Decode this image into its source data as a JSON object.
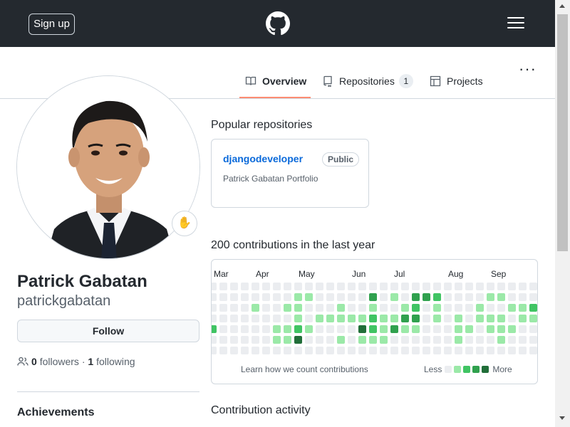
{
  "header": {
    "signup_label": "Sign up",
    "logo_icon": "github-icon",
    "menu_icon": "hamburger-menu-icon"
  },
  "tabs": [
    {
      "label": "Overview",
      "icon": "book-icon",
      "selected": true
    },
    {
      "label": "Repositories",
      "icon": "repo-icon",
      "count": "1"
    },
    {
      "label": "Projects",
      "icon": "table-icon"
    }
  ],
  "more_menu": "···",
  "profile": {
    "name": "Patrick Gabatan",
    "login": "patrickgabatan",
    "follow_label": "Follow",
    "followers_count": "0",
    "followers_label": "followers",
    "separator": "·",
    "following_count": "1",
    "following_label": "following",
    "status_emoji": "✋",
    "achievements_heading": "Achievements"
  },
  "popular": {
    "heading": "Popular repositories",
    "repos": [
      {
        "name": "djangodeveloper",
        "visibility": "Public",
        "description": "Patrick Gabatan Portfolio"
      }
    ]
  },
  "contributions": {
    "heading": "200 contributions in the last year",
    "months": [
      "Mar",
      "Apr",
      "May",
      "Jun",
      "Jul",
      "Aug",
      "Sep"
    ],
    "learn_link": "Learn how we count contributions",
    "legend_less": "Less",
    "legend_more": "More",
    "colors": [
      "#ebedf0",
      "#9be9a8",
      "#40c463",
      "#30a14e",
      "#216e39"
    ],
    "weeks": [
      [
        0,
        0,
        0,
        0,
        2,
        0,
        0
      ],
      [
        0,
        0,
        0,
        0,
        0,
        0,
        0
      ],
      [
        0,
        0,
        0,
        0,
        0,
        0,
        0
      ],
      [
        0,
        0,
        0,
        0,
        0,
        0,
        0
      ],
      [
        0,
        0,
        1,
        0,
        0,
        0,
        0
      ],
      [
        0,
        0,
        0,
        0,
        0,
        0,
        0
      ],
      [
        0,
        0,
        0,
        0,
        1,
        1,
        0
      ],
      [
        0,
        0,
        1,
        0,
        1,
        1,
        0
      ],
      [
        0,
        1,
        1,
        1,
        2,
        4,
        0
      ],
      [
        0,
        1,
        0,
        0,
        1,
        0,
        0
      ],
      [
        0,
        0,
        0,
        1,
        0,
        0,
        0
      ],
      [
        0,
        0,
        0,
        1,
        0,
        0,
        0
      ],
      [
        0,
        0,
        1,
        1,
        0,
        1,
        0
      ],
      [
        0,
        0,
        0,
        1,
        0,
        0,
        0
      ],
      [
        0,
        0,
        0,
        1,
        4,
        1,
        0
      ],
      [
        0,
        3,
        1,
        2,
        2,
        1,
        0
      ],
      [
        0,
        0,
        0,
        1,
        1,
        1,
        0
      ],
      [
        0,
        1,
        0,
        1,
        3,
        0,
        0
      ],
      [
        0,
        0,
        1,
        3,
        1,
        0,
        0
      ],
      [
        0,
        3,
        2,
        3,
        1,
        0,
        0
      ],
      [
        0,
        3,
        0,
        0,
        0,
        0,
        0
      ],
      [
        0,
        2,
        1,
        1,
        0,
        0,
        0
      ],
      [
        0,
        0,
        0,
        0,
        0,
        0,
        0
      ],
      [
        0,
        0,
        0,
        1,
        1,
        1,
        0
      ],
      [
        0,
        0,
        0,
        0,
        1,
        0,
        0
      ],
      [
        0,
        0,
        1,
        1,
        0,
        0,
        0
      ],
      [
        0,
        1,
        0,
        1,
        1,
        0,
        0
      ],
      [
        0,
        1,
        0,
        1,
        1,
        1,
        0
      ],
      [
        0,
        0,
        1,
        0,
        1,
        0,
        0
      ],
      [
        0,
        0,
        1,
        1,
        0,
        0,
        0
      ],
      [
        0,
        0,
        2,
        1,
        0,
        0,
        0
      ],
      [
        0,
        0,
        2,
        0,
        0,
        0,
        0
      ],
      [
        0,
        1,
        2,
        0,
        1,
        1,
        0
      ],
      [
        0,
        0,
        0,
        1,
        0,
        1,
        0
      ],
      [
        0,
        1,
        0,
        0,
        0,
        0,
        0
      ],
      [
        0,
        0,
        0,
        0,
        0,
        0,
        0
      ]
    ]
  },
  "activity": {
    "heading": "Contribution activity"
  }
}
